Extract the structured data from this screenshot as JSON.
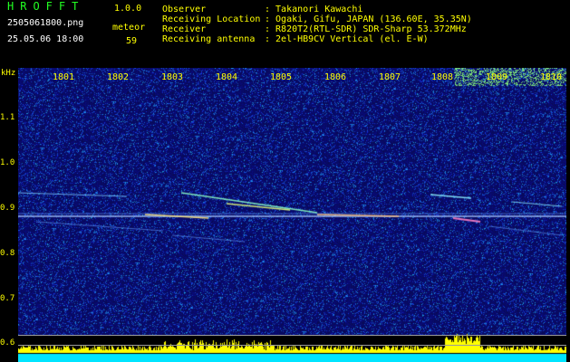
{
  "header": {
    "app_title": "HROFFT",
    "version": "1.0.0",
    "filename": "2505061800.png",
    "datetime": "25.05.06 18:00",
    "meteor_label": "meteor",
    "meteor_count": "59"
  },
  "info": [
    {
      "key": "Observer",
      "value": ": Takanori Kawachi"
    },
    {
      "key": "Receiving Location",
      "value": ": Ogaki, Gifu, JAPAN (136.60E, 35.35N)"
    },
    {
      "key": "Receiver",
      "value": ": R820T2(RTL-SDR) SDR-Sharp 53.372MHz"
    },
    {
      "key": "Receiving antenna",
      "value": ": 2el-HB9CV Vertical (el. E-W)"
    }
  ],
  "axis": {
    "unit": "kHz",
    "y_ticks": [
      "1.1",
      "1.0",
      "0.9",
      "0.8",
      "0.7",
      "0.6"
    ],
    "x_ticks": [
      "1801",
      "1802",
      "1803",
      "1804",
      "1805",
      "1806",
      "1807",
      "1808",
      "1809",
      "1810"
    ]
  },
  "colors": {
    "background": "#000000",
    "label_yellow": "#ffff00",
    "title_green": "#22ff22",
    "noise_base": "#0a0a6e",
    "baseline_cyan": "#00e5ff"
  }
}
